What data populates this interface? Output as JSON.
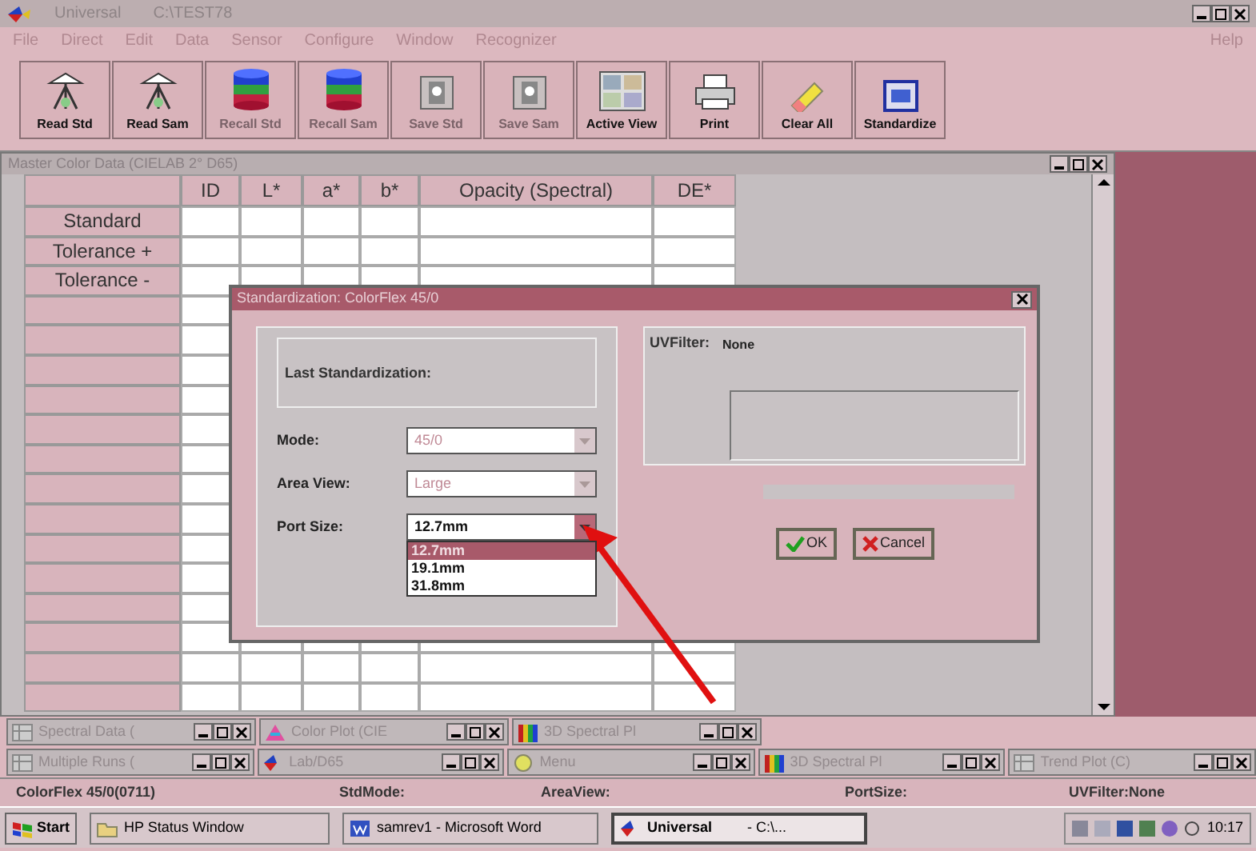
{
  "window": {
    "title": "Universal",
    "path": "C:\\TEST78"
  },
  "menu": [
    {
      "label": "File"
    },
    {
      "label": "Direct"
    },
    {
      "label": "Edit"
    },
    {
      "label": "Data"
    },
    {
      "label": "Sensor"
    },
    {
      "label": "Configure"
    },
    {
      "label": "Window"
    },
    {
      "label": "Recognizer"
    }
  ],
  "help": "Help",
  "toolbar": [
    {
      "label": "Read Std",
      "kind": "tripod",
      "disabled": false
    },
    {
      "label": "Read Sam",
      "kind": "tripod",
      "disabled": false
    },
    {
      "label": "Recall Std",
      "kind": "database",
      "disabled": true
    },
    {
      "label": "Recall Sam",
      "kind": "database",
      "disabled": true
    },
    {
      "label": "Save Std",
      "kind": "save",
      "disabled": true
    },
    {
      "label": "Save Sam",
      "kind": "save",
      "disabled": true
    },
    {
      "label": "Active View",
      "kind": "views",
      "disabled": false
    },
    {
      "label": "Print",
      "kind": "print",
      "disabled": false
    },
    {
      "label": "Clear All",
      "kind": "eraser",
      "disabled": false
    },
    {
      "label": "Standardize",
      "kind": "standardize",
      "disabled": false
    }
  ],
  "child_window": {
    "title": "Master Color Data (CIELAB 2° D65)",
    "columns": [
      "ID",
      "L*",
      "a*",
      "b*",
      "Opacity (Spectral)",
      "DE*"
    ],
    "rows": [
      "Standard",
      "Tolerance +",
      "Tolerance -"
    ]
  },
  "dialog": {
    "title": "Standardization: ColorFlex 45/0",
    "last_standardization": "Last Standardization:",
    "uv_filter_label": "UVFilter:",
    "uv_filter_value": "None",
    "fields": [
      {
        "label": "Mode:",
        "value": "45/0",
        "disabled": true,
        "expanded": false
      },
      {
        "label": "Area View:",
        "value": "Large",
        "disabled": true,
        "expanded": false
      },
      {
        "label": "Port Size:",
        "value": "12.7mm",
        "disabled": false,
        "expanded": true
      }
    ],
    "options": [
      {
        "label": "12.7mm",
        "selected": true
      },
      {
        "label": "19.1mm",
        "selected": false
      },
      {
        "label": "31.8mm",
        "selected": false
      }
    ],
    "progress": {
      "level": 0
    },
    "buttons": [
      {
        "label": "OK",
        "kind": "ok"
      },
      {
        "label": "Cancel",
        "kind": "cancel"
      }
    ]
  },
  "minimized_windows": [
    [
      {
        "title": "Spectral Data (",
        "kind": "grid"
      },
      {
        "title": "Color Plot (CIE",
        "kind": "plot"
      },
      {
        "title": "3D Spectral Pl",
        "kind": "spectrum"
      }
    ],
    [
      {
        "title": "Multiple Runs (",
        "kind": "grid"
      },
      {
        "title": "Lab/D65",
        "kind": "app"
      },
      {
        "title": "Menu",
        "kind": "menu"
      },
      {
        "title": "3D Spectral Pl",
        "kind": "spectrum"
      },
      {
        "title": "Trend Plot (C)",
        "kind": "grid"
      }
    ]
  ],
  "status_bar": [
    "ColorFlex 45/0(0711)",
    "StdMode:",
    "AreaView:",
    "PortSize:",
    "UVFilter:None"
  ],
  "taskbar": {
    "start": "Start",
    "tasks": [
      {
        "label": "HP Status Window",
        "kind": "folder",
        "selected": false
      },
      {
        "label": "samrev1 - Microsoft Word",
        "kind": "word",
        "selected": false
      },
      {
        "label": "Universal",
        "detail": "- C:\\...",
        "kind": "app",
        "selected": true
      }
    ],
    "clock": "10:17"
  }
}
